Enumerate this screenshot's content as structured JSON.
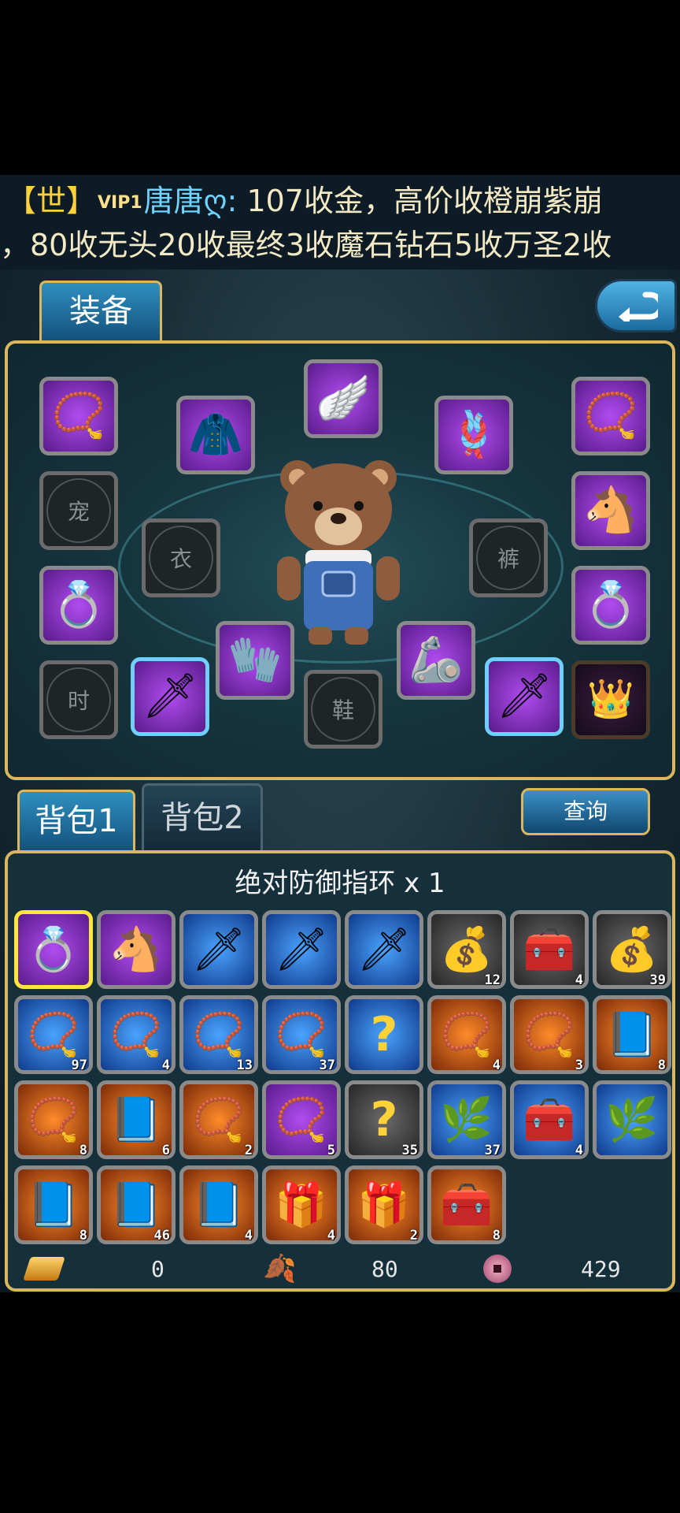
{
  "chat": {
    "channel_tag": "【世】",
    "vip_badge": "VIP1",
    "speaker": "唐唐ღ:",
    "line1_message": " 107收金，高价收橙崩紫崩",
    "line2": "，80收无头20收最终3收魔石钻石5收万圣2收"
  },
  "equipment": {
    "tab_label": "装备",
    "slot_labels": {
      "pet": "宠",
      "clothes": "衣",
      "pants": "裤",
      "fashion": "时",
      "shoes": "鞋"
    },
    "vip_crown_text": "VIP"
  },
  "bag": {
    "tabs": [
      "背包1",
      "背包2"
    ],
    "query_label": "查询",
    "selected_item_name": "绝对防御指环 x 1",
    "rows": [
      [
        {
          "icon": "ring-icon",
          "color": "purple",
          "count": "",
          "selected": true
        },
        {
          "icon": "horse-icon",
          "color": "purple",
          "count": ""
        },
        {
          "icon": "sword-icon",
          "color": "blue",
          "count": ""
        },
        {
          "icon": "sword-icon",
          "color": "blue",
          "count": ""
        },
        {
          "icon": "sword-icon",
          "color": "blue",
          "count": ""
        },
        {
          "icon": "pouch-icon",
          "color": "gray",
          "count": "12"
        },
        {
          "icon": "chest-icon",
          "color": "gray",
          "count": "4"
        },
        {
          "icon": "pouch-icon",
          "color": "gray",
          "count": "39"
        }
      ],
      [
        {
          "icon": "necklace-icon",
          "color": "blue",
          "count": "97"
        },
        {
          "icon": "necklace-icon",
          "color": "blue",
          "count": "4"
        },
        {
          "icon": "necklace-icon",
          "color": "blue",
          "count": "13"
        },
        {
          "icon": "necklace-icon",
          "color": "blue",
          "count": "37"
        },
        {
          "icon": "question-icon",
          "color": "blue",
          "count": ""
        },
        {
          "icon": "necklace-icon",
          "color": "orange",
          "count": "4"
        },
        {
          "icon": "necklace-icon",
          "color": "orange",
          "count": "3"
        },
        {
          "icon": "book-icon",
          "color": "orange",
          "count": "8"
        }
      ],
      [
        {
          "icon": "necklace-icon",
          "color": "orange",
          "count": "8"
        },
        {
          "icon": "book-icon",
          "color": "orange",
          "count": "6"
        },
        {
          "icon": "necklace-icon",
          "color": "orange",
          "count": "2"
        },
        {
          "icon": "necklace-icon",
          "color": "purple",
          "count": "5"
        },
        {
          "icon": "question-icon",
          "color": "gray",
          "count": "35"
        },
        {
          "icon": "herb-icon",
          "color": "blue",
          "count": "37"
        },
        {
          "icon": "chest-icon",
          "color": "blue",
          "count": "4"
        },
        {
          "icon": "herb-icon",
          "color": "blue",
          "count": ""
        }
      ],
      [
        {
          "icon": "book-icon",
          "color": "orange",
          "count": "8"
        },
        {
          "icon": "book-icon",
          "color": "orange",
          "count": "46"
        },
        {
          "icon": "book-icon",
          "color": "orange",
          "count": "4"
        },
        {
          "icon": "gift-icon",
          "color": "orange",
          "count": "4"
        },
        {
          "icon": "gift-icon",
          "color": "orange",
          "count": "2"
        },
        {
          "icon": "chest-icon",
          "color": "orange",
          "count": "8"
        }
      ]
    ]
  },
  "currency": {
    "gold": "0",
    "leaf": "80",
    "coin": "429"
  },
  "colors": {
    "frame_gold": "#d9b65f",
    "rarity_purple": "#8a2fc8",
    "rarity_blue": "#1f66d0",
    "rarity_orange": "#d0561a"
  }
}
